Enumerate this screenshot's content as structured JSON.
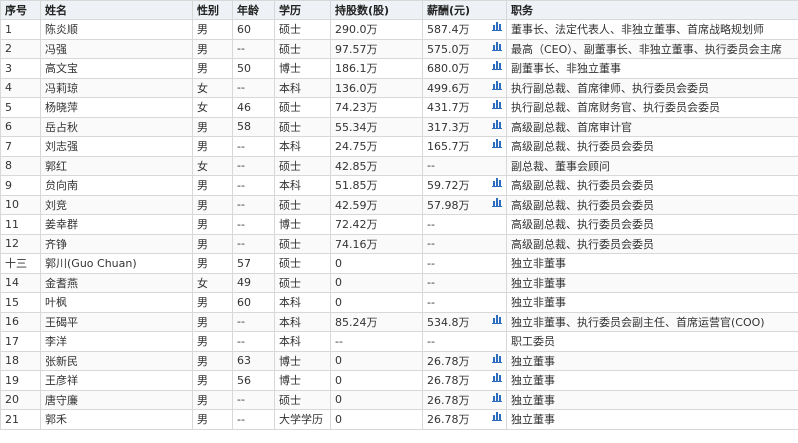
{
  "headers": [
    "序号",
    "姓名",
    "性别",
    "年龄",
    "学历",
    "持股数(股)",
    "薪酬(元)",
    "职务"
  ],
  "icon": {
    "name": "bar-chart-icon",
    "color": "#2d6dbf"
  },
  "rows": [
    {
      "no": "1",
      "name": "陈炎顺",
      "gender": "男",
      "age": "60",
      "edu": "硕士",
      "shares": "290.0万",
      "pay": "587.4万",
      "chart": true,
      "title": "董事长、法定代表人、非独立董事、首席战略规划师"
    },
    {
      "no": "2",
      "name": "冯强",
      "gender": "男",
      "age": "--",
      "edu": "硕士",
      "shares": "97.57万",
      "pay": "575.0万",
      "chart": true,
      "title": "最高（CEO）、副董事长、非独立董事、执行委员会主席"
    },
    {
      "no": "3",
      "name": "高文宝",
      "gender": "男",
      "age": "50",
      "edu": "博士",
      "shares": "186.1万",
      "pay": "680.0万",
      "chart": true,
      "title": "副董事长、非独立董事"
    },
    {
      "no": "4",
      "name": "冯莉琼",
      "gender": "女",
      "age": "--",
      "edu": "本科",
      "shares": "136.0万",
      "pay": "499.6万",
      "chart": true,
      "title": "执行副总裁、首席律师、执行委员会委员"
    },
    {
      "no": "5",
      "name": "杨晓萍",
      "gender": "女",
      "age": "46",
      "edu": "硕士",
      "shares": "74.23万",
      "pay": "431.7万",
      "chart": true,
      "title": "执行副总裁、首席财务官、执行委员会委员"
    },
    {
      "no": "6",
      "name": "岳占秋",
      "gender": "男",
      "age": "58",
      "edu": "硕士",
      "shares": "55.34万",
      "pay": "317.3万",
      "chart": true,
      "title": "高级副总裁、首席审计官"
    },
    {
      "no": "7",
      "name": "刘志强",
      "gender": "男",
      "age": "--",
      "edu": "本科",
      "shares": "24.75万",
      "pay": "165.7万",
      "chart": true,
      "title": "高级副总裁、执行委员会委员"
    },
    {
      "no": "8",
      "name": "郭红",
      "gender": "女",
      "age": "--",
      "edu": "硕士",
      "shares": "42.85万",
      "pay": "--",
      "chart": false,
      "title": "副总裁、董事会顾问"
    },
    {
      "no": "9",
      "name": "贠向南",
      "gender": "男",
      "age": "--",
      "edu": "本科",
      "shares": "51.85万",
      "pay": "59.72万",
      "chart": true,
      "title": "高级副总裁、执行委员会委员"
    },
    {
      "no": "10",
      "name": "刘竞",
      "gender": "男",
      "age": "--",
      "edu": "硕士",
      "shares": "42.59万",
      "pay": "57.98万",
      "chart": true,
      "title": "高级副总裁、执行委员会委员"
    },
    {
      "no": "11",
      "name": "姜幸群",
      "gender": "男",
      "age": "--",
      "edu": "博士",
      "shares": "72.42万",
      "pay": "--",
      "chart": false,
      "title": "高级副总裁、执行委员会委员"
    },
    {
      "no": "12",
      "name": "齐铮",
      "gender": "男",
      "age": "--",
      "edu": "硕士",
      "shares": "74.16万",
      "pay": "--",
      "chart": false,
      "title": "高级副总裁、执行委员会委员"
    },
    {
      "no": "十三",
      "name": "郭川(Guo Chuan)",
      "gender": "男",
      "age": "57",
      "edu": "硕士",
      "shares": "0",
      "pay": "--",
      "chart": false,
      "title": "独立非董事"
    },
    {
      "no": "14",
      "name": "金耆燕",
      "gender": "女",
      "age": "49",
      "edu": "硕士",
      "shares": "0",
      "pay": "--",
      "chart": false,
      "title": "独立非董事"
    },
    {
      "no": "15",
      "name": "叶枫",
      "gender": "男",
      "age": "60",
      "edu": "本科",
      "shares": "0",
      "pay": "--",
      "chart": false,
      "title": "独立非董事"
    },
    {
      "no": "16",
      "name": "王碣平",
      "gender": "男",
      "age": "--",
      "edu": "本科",
      "shares": "85.24万",
      "pay": "534.8万",
      "chart": true,
      "title": "独立非董事、执行委员会副主任、首席运营官(COO)"
    },
    {
      "no": "17",
      "name": "李洋",
      "gender": "男",
      "age": "--",
      "edu": "本科",
      "shares": "--",
      "pay": "--",
      "chart": false,
      "title": "职工委员"
    },
    {
      "no": "18",
      "name": "张新民",
      "gender": "男",
      "age": "63",
      "edu": "博士",
      "shares": "0",
      "pay": "26.78万",
      "chart": true,
      "title": "独立董事"
    },
    {
      "no": "19",
      "name": "王彦祥",
      "gender": "男",
      "age": "56",
      "edu": "博士",
      "shares": "0",
      "pay": "26.78万",
      "chart": true,
      "title": "独立董事"
    },
    {
      "no": "20",
      "name": "唐守廉",
      "gender": "男",
      "age": "--",
      "edu": "硕士",
      "shares": "0",
      "pay": "26.78万",
      "chart": true,
      "title": "独立董事"
    },
    {
      "no": "21",
      "name": "郭禾",
      "gender": "男",
      "age": "--",
      "edu": "大学学历",
      "shares": "0",
      "pay": "26.78万",
      "chart": true,
      "title": "独立董事"
    }
  ]
}
